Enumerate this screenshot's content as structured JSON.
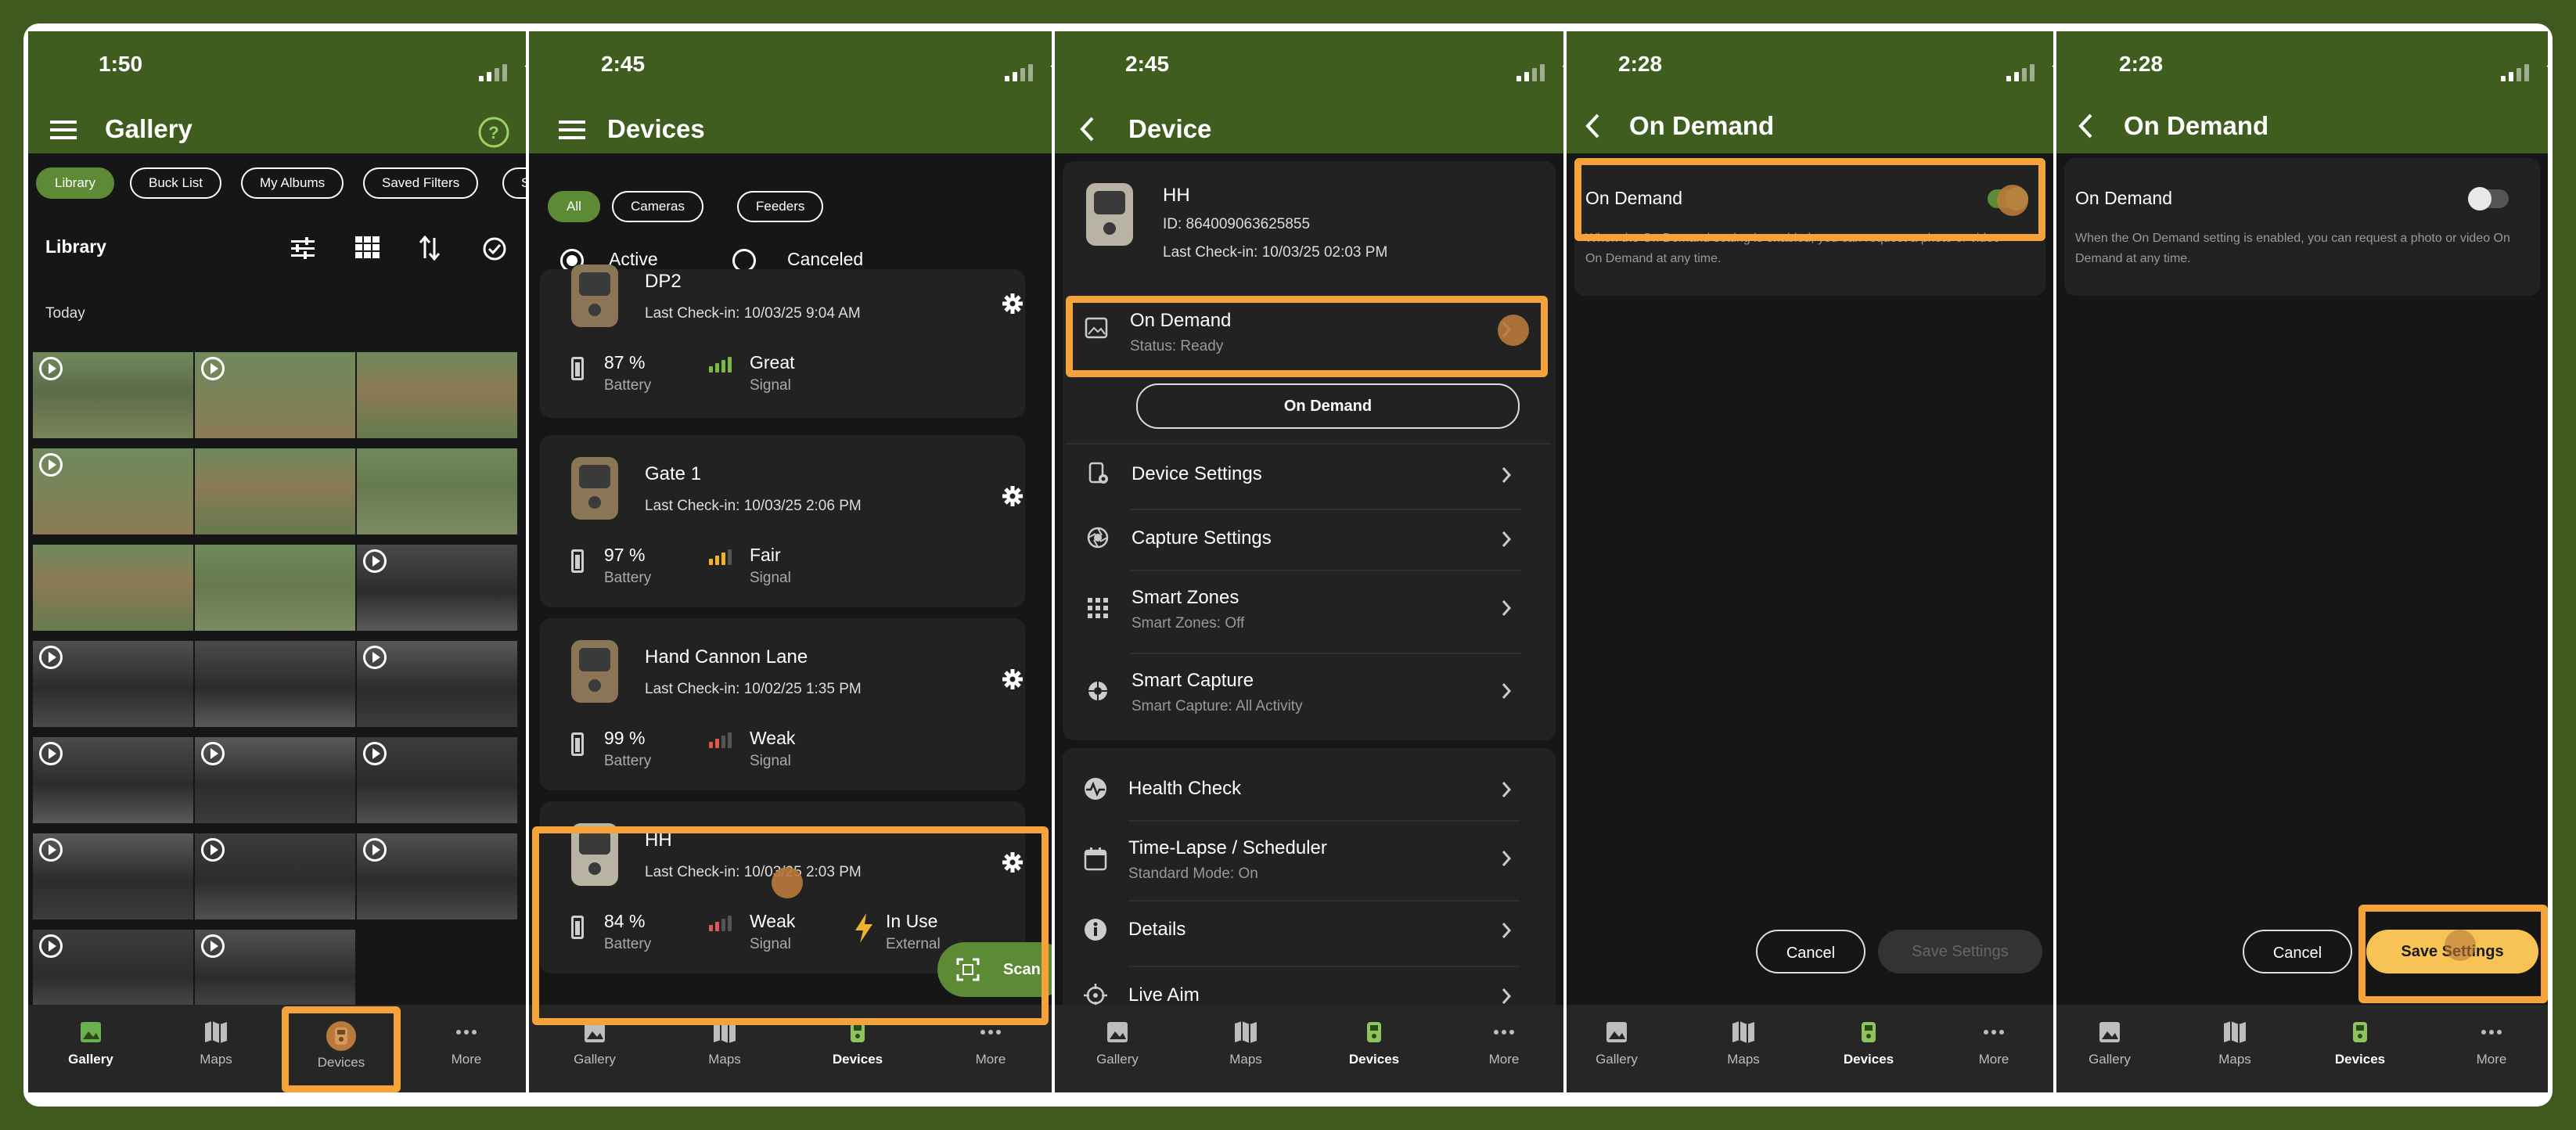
{
  "colors": {
    "header_green": "#3f5d1e",
    "accent_orange": "#f4a23a",
    "chip_green": "#5c8a35",
    "save_yellow": "#f6c354",
    "signal_green": "#7ab648",
    "signal_yellow": "#f0b429",
    "signal_red": "#e05a4a"
  },
  "tabbar": {
    "gallery": "Gallery",
    "maps": "Maps",
    "devices": "Devices",
    "more": "More"
  },
  "gallery": {
    "time": "1:50",
    "title": "Gallery",
    "chips": [
      "Library",
      "Buck List",
      "My Albums",
      "Saved Filters",
      "Sma"
    ],
    "section_title": "Library",
    "date_label": "Today",
    "icons": [
      "menu-icon",
      "help-icon",
      "filter-icon",
      "grid-icon",
      "sort-icon",
      "select-icon"
    ]
  },
  "devices": {
    "time": "2:45",
    "title": "Devices",
    "chips": [
      "All",
      "Cameras",
      "Feeders"
    ],
    "status_active": "Active",
    "status_canceled": "Canceled",
    "battery_label": "Battery",
    "signal_label": "Signal",
    "items": [
      {
        "name": "DP2",
        "checkin": "Last Check-in: 10/03/25 9:04 AM",
        "battery": "87 %",
        "signal": "Great"
      },
      {
        "name": "Gate 1",
        "checkin": "Last Check-in: 10/03/25 2:06 PM",
        "battery": "97 %",
        "signal": "Fair"
      },
      {
        "name": "Hand Cannon Lane",
        "checkin": "Last Check-in: 10/02/25 1:35 PM",
        "battery": "99 %",
        "signal": "Weak"
      },
      {
        "name": "HH",
        "checkin": "Last Check-in: 10/03/25 2:03 PM",
        "battery": "84 %",
        "signal": "Weak",
        "power": "In Use",
        "power_sub": "External"
      }
    ],
    "scan_label": "Scan"
  },
  "device": {
    "time": "2:45",
    "title": "Device",
    "name": "HH",
    "id": "ID: 864009063625855",
    "checkin": "Last Check-in: 10/03/25 02:03 PM",
    "on_demand_title": "On Demand",
    "on_demand_status": "Status: Ready",
    "on_demand_button": "On Demand",
    "settings": [
      {
        "title": "Device Settings",
        "sub": ""
      },
      {
        "title": "Capture Settings",
        "sub": ""
      },
      {
        "title": "Smart Zones",
        "sub": "Smart Zones: Off"
      },
      {
        "title": "Smart Capture",
        "sub": "Smart Capture: All Activity"
      }
    ],
    "more": [
      {
        "title": "Health Check",
        "sub": ""
      },
      {
        "title": "Time-Lapse / Scheduler",
        "sub": "Standard Mode: On"
      },
      {
        "title": "Details",
        "sub": ""
      },
      {
        "title": "Live Aim",
        "sub": ""
      }
    ]
  },
  "ondemand1": {
    "time": "2:28",
    "title": "On Demand",
    "toggle_label": "On Demand",
    "description": "When the On Demand setting is enabled, you can request a photo or video On Demand at any time.",
    "cancel": "Cancel",
    "save": "Save Settings",
    "toggle_on": true
  },
  "ondemand2": {
    "time": "2:28",
    "title": "On Demand",
    "toggle_label": "On Demand",
    "description": "When the On Demand setting is enabled, you can request a photo or video On Demand at any time.",
    "cancel": "Cancel",
    "save": "Save Settings",
    "toggle_on": false
  }
}
